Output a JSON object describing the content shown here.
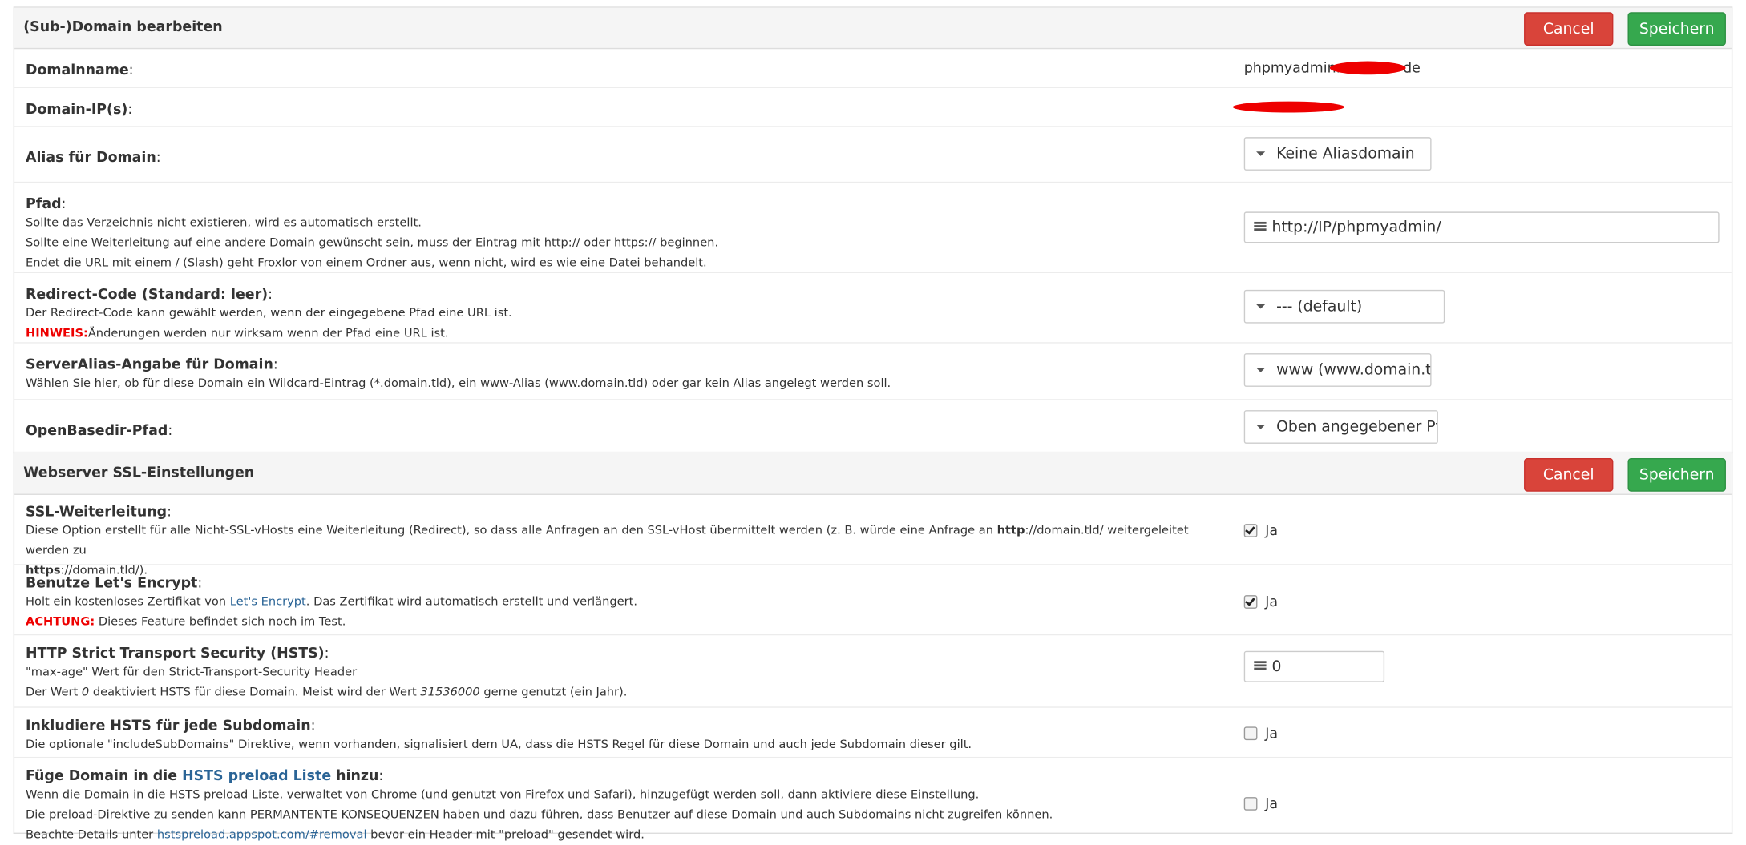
{
  "panel_domain": {
    "title": "(Sub-)Domain bearbeiten",
    "cancel_label": "Cancel",
    "save_label": "Speichern",
    "domainname": {
      "label": "Domainname",
      "colon": ":",
      "value_prefix": "phpmyadmin.",
      "value_suffix": "de"
    },
    "domain_ip": {
      "label": "Domain-IP(s)",
      "colon": ":"
    },
    "alias": {
      "label": "Alias für Domain",
      "colon": ":",
      "selected": "Keine Aliasdomain"
    },
    "pfad": {
      "label": "Pfad",
      "colon": ":",
      "desc1": "Sollte das Verzeichnis nicht existieren, wird es automatisch erstellt.",
      "desc2": "Sollte eine Weiterleitung auf eine andere Domain gewünscht sein, muss der Eintrag mit http:// oder https:// beginnen.",
      "desc3": "Endet die URL mit einem / (Slash) geht Froxlor von einem Ordner aus, wenn nicht, wird es wie eine Datei behandelt.",
      "value": "http://IP/phpmyadmin/"
    },
    "redirect": {
      "label": "Redirect-Code (Standard: leer)",
      "colon": ":",
      "desc1": "Der Redirect-Code kann gewählt werden, wenn der eingegebene Pfad eine URL ist.",
      "hint_label": "HINWEIS:",
      "hint_text": "Änderungen werden nur wirksam wenn der Pfad eine URL ist.",
      "selected": "--- (default)"
    },
    "serveralias": {
      "label": "ServerAlias-Angabe für Domain",
      "colon": ":",
      "desc1": "Wählen Sie hier, ob für diese Domain ein Wildcard-Eintrag (*.domain.tld), ein www-Alias (www.domain.tld) oder gar kein Alias angelegt werden soll.",
      "selected": "www (www.domain.tld)"
    },
    "openbasedir": {
      "label": "OpenBasedir-Pfad",
      "colon": ":",
      "selected": "Oben angegebener Pfad"
    }
  },
  "panel_ssl": {
    "title": "Webserver SSL-Einstellungen",
    "cancel_label": "Cancel",
    "save_label": "Speichern",
    "ssl_redirect": {
      "label": "SSL-Weiterleitung",
      "colon": ":",
      "desc1a": "Diese Option erstellt für alle Nicht-SSL-vHosts eine Weiterleitung (Redirect), so dass alle Anfragen an den SSL-vHost übermittelt werden (z. B. würde eine Anfrage an ",
      "desc1b": "http",
      "desc1c": "://domain.tld/ weitergeleitet werden zu",
      "desc2a": "https",
      "desc2b": "://domain.tld/).",
      "checkbox_label": "Ja",
      "checked": true
    },
    "letsencrypt": {
      "label": "Benutze Let's Encrypt",
      "colon": ":",
      "desc1a": "Holt ein kostenloses Zertifikat von ",
      "desc1_link": "Let's Encrypt",
      "desc1b": ". Das Zertifikat wird automatisch erstellt und verlängert.",
      "warn_label": "ACHTUNG:",
      "warn_text": " Dieses Feature befindet sich noch im Test.",
      "checkbox_label": "Ja",
      "checked": true
    },
    "hsts": {
      "label": "HTTP Strict Transport Security (HSTS)",
      "colon": ":",
      "desc1": "\"max-age\" Wert für den Strict-Transport-Security Header",
      "desc2a": "Der Wert ",
      "desc2b": "0",
      "desc2c": " deaktiviert HSTS für diese Domain. Meist wird der Wert ",
      "desc2d": "31536000",
      "desc2e": " gerne genutzt (ein Jahr).",
      "value": "0"
    },
    "hsts_sub": {
      "label": "Inkludiere HSTS für jede Subdomain",
      "colon": ":",
      "desc1": "Die optionale \"includeSubDomains\" Direktive, wenn vorhanden, signalisiert dem UA, dass die HSTS Regel für diese Domain und auch jede Subdomain dieser gilt.",
      "checkbox_label": "Ja",
      "checked": false
    },
    "hsts_preload": {
      "label_a": "Füge Domain in die ",
      "label_link": "HSTS preload Liste",
      "label_b": " hinzu",
      "colon": ":",
      "desc1": "Wenn die Domain in die HSTS preload Liste, verwaltet von Chrome (und genutzt von Firefox und Safari), hinzugefügt werden soll, dann aktiviere diese Einstellung.",
      "desc2": "Die preload-Direktive zu senden kann PERMANTENTE KONSEQUENZEN haben und dazu führen, dass Benutzer auf diese Domain und auch Subdomains nicht zugreifen können.",
      "desc3a": "Beachte Details unter ",
      "desc3_link": "hstspreload.appspot.com/#removal",
      "desc3b": " bevor ein Header mit \"preload\" gesendet wird.",
      "checkbox_label": "Ja",
      "checked": false
    }
  },
  "colors": {
    "cancel": "#d9443a",
    "save": "#36a84e",
    "header_bg": "#f5f5f5",
    "warn": "#ee0000",
    "link": "#2a6496"
  }
}
